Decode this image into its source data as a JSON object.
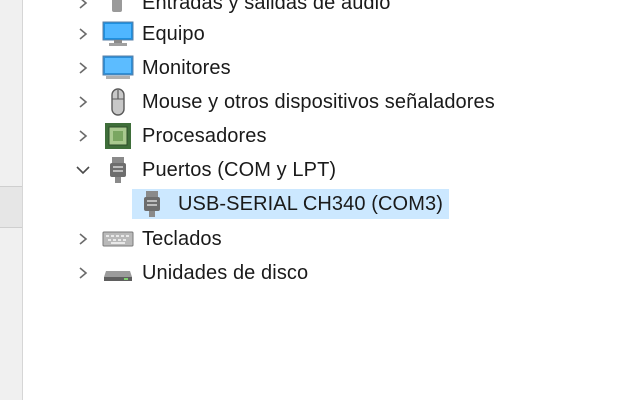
{
  "tree": {
    "items": [
      {
        "label": "Entradas y salidas de audio",
        "icon": "audio-io-icon",
        "expanded": false
      },
      {
        "label": "Equipo",
        "icon": "computer-icon",
        "expanded": false
      },
      {
        "label": "Monitores",
        "icon": "monitor-icon",
        "expanded": false
      },
      {
        "label": "Mouse y otros dispositivos señaladores",
        "icon": "mouse-icon",
        "expanded": false
      },
      {
        "label": "Procesadores",
        "icon": "processor-icon",
        "expanded": false
      },
      {
        "label": "Puertos (COM y LPT)",
        "icon": "port-icon",
        "expanded": true,
        "children": [
          {
            "label": "USB-SERIAL CH340 (COM3)",
            "icon": "serial-port-icon",
            "selected": true
          }
        ]
      },
      {
        "label": "Teclados",
        "icon": "keyboard-icon",
        "expanded": false
      },
      {
        "label": "Unidades de disco",
        "icon": "disk-drive-icon",
        "expanded": false
      }
    ]
  },
  "colors": {
    "selection": "#cce8ff",
    "chevron": "#6b6b6b"
  }
}
